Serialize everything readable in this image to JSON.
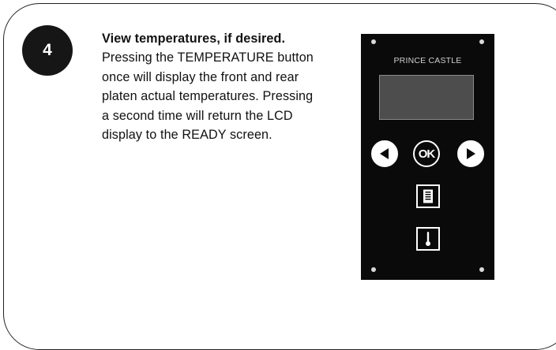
{
  "step": {
    "number": "4"
  },
  "instruction": {
    "heading": "View temperatures, if desired.",
    "body": "Pressing the TEMPERATURE button once will display the front and rear platen actual temperatures. Pressing a second time will return the LCD display to the READY screen."
  },
  "control_panel": {
    "brand": "PRINCE CASTLE",
    "buttons": {
      "left_icon": "left-arrow-icon",
      "ok_label": "OK",
      "right_icon": "right-arrow-icon",
      "menu_icon": "menu-list-icon",
      "temperature_icon": "thermometer-icon"
    }
  },
  "colors": {
    "panel": "#0a0a0a",
    "lcd": "#4d4d4d",
    "badge": "#161616"
  }
}
